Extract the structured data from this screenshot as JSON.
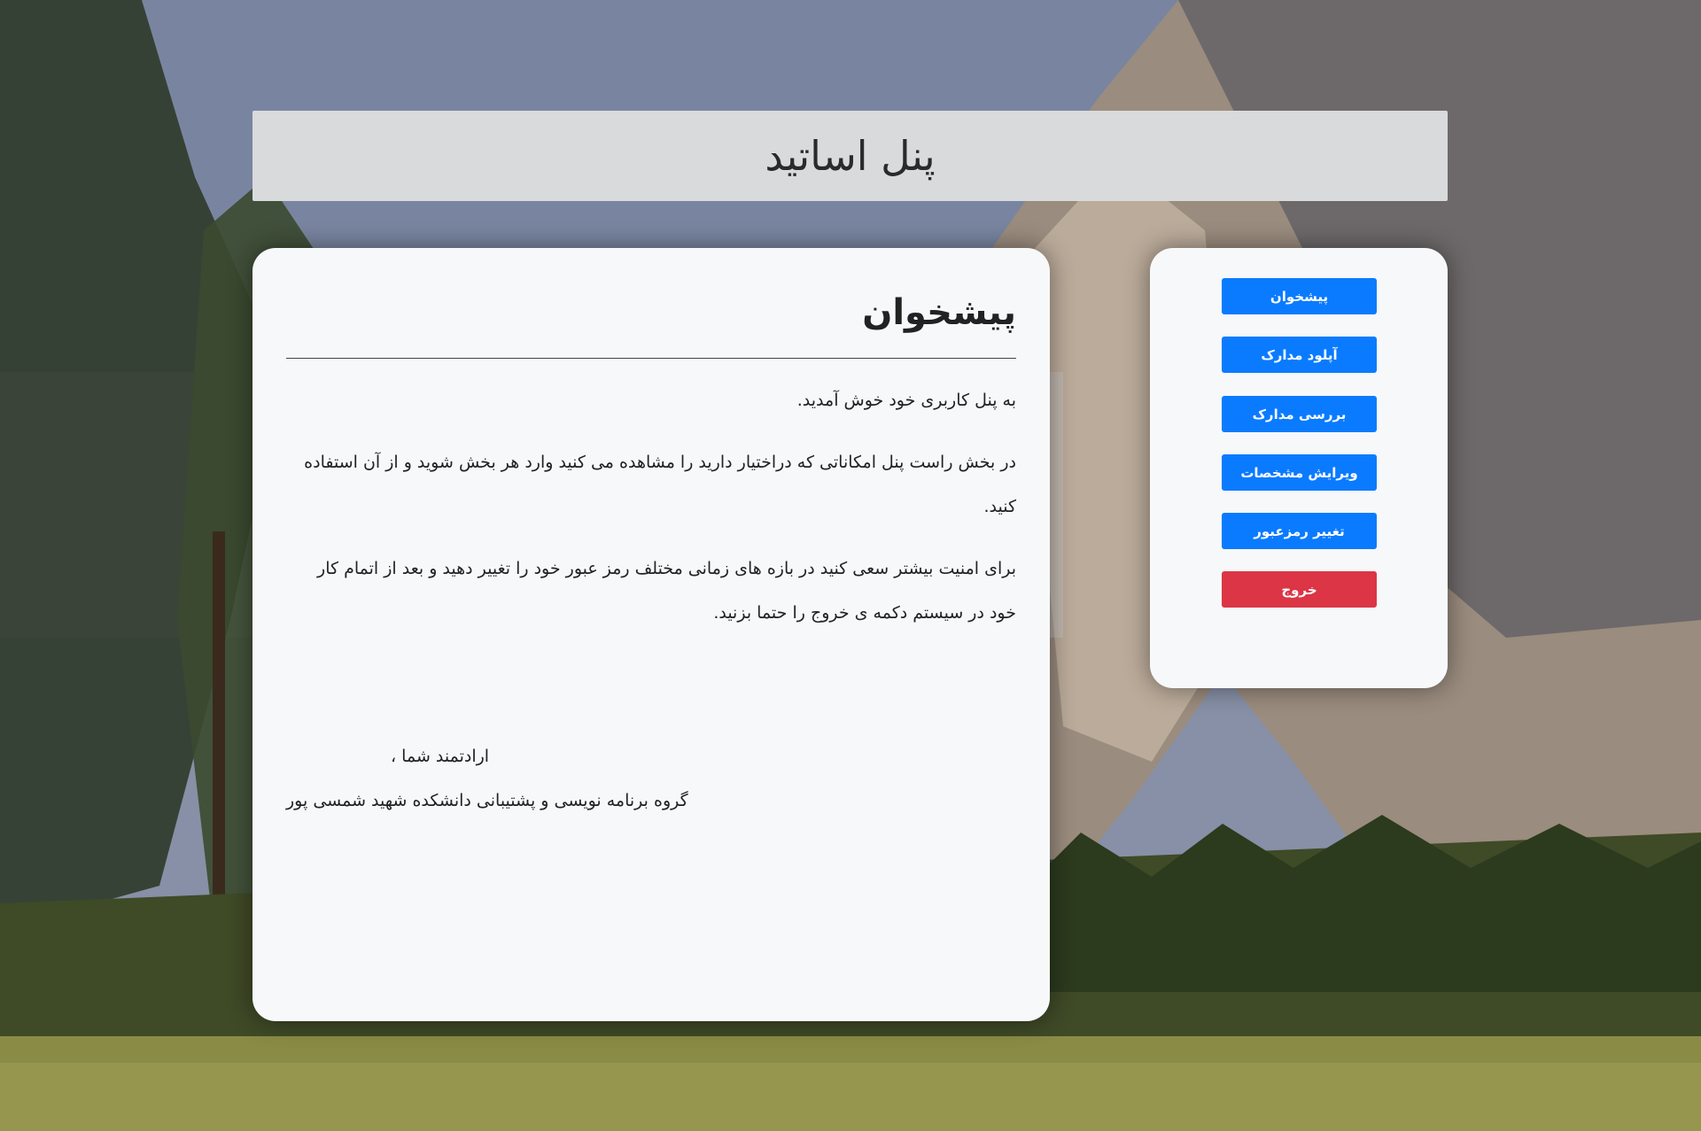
{
  "header": {
    "title": "پنل اساتید"
  },
  "main": {
    "title": "پیشخوان",
    "paragraphs": [
      "به پنل کاربری خود خوش آمدید.",
      "در بخش راست پنل امکاناتی که دراختیار دارید را مشاهده می کنید وارد هر بخش شوید و از آن استفاده کنید.",
      "برای امنیت بیشتر سعی کنید در بازه های زمانی مختلف رمز عبور خود را تغییر دهید و بعد از اتمام کار خود در سیستم دکمه ی خروج را حتما بزنید."
    ],
    "signoff_line1": "ارادتمند شما ،",
    "signoff_line2": "گروه برنامه نویسی و پشتیبانی دانشکده شهید شمسی پور"
  },
  "sidebar": {
    "items": [
      {
        "label": "پیشخوان",
        "style": "primary"
      },
      {
        "label": "آپلود مدارک",
        "style": "primary"
      },
      {
        "label": "بررسی مدارک",
        "style": "primary"
      },
      {
        "label": "ویرایش مشخصات",
        "style": "primary"
      },
      {
        "label": "تغییر رمزعبور",
        "style": "primary"
      },
      {
        "label": "خروج",
        "style": "danger"
      }
    ]
  },
  "colors": {
    "primary": "#0a7bff",
    "danger": "#dc3545",
    "header_bg": "#d9dadc",
    "card_bg": "#f7f8fa"
  }
}
